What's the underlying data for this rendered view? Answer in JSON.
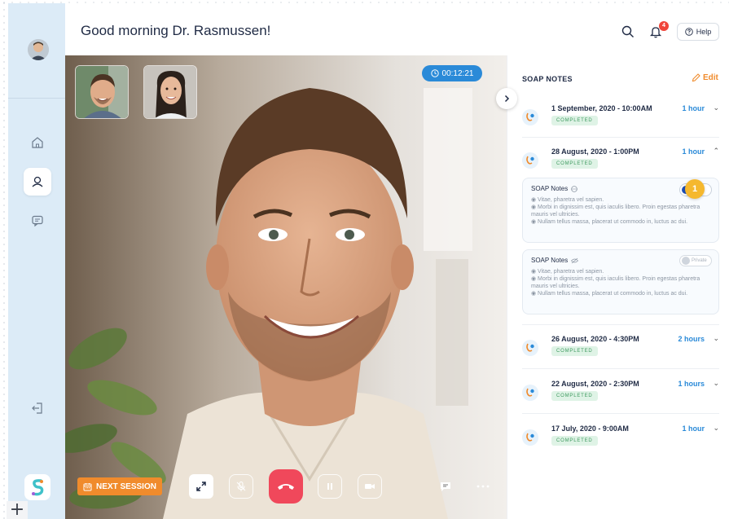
{
  "header": {
    "greeting": "Good morning Dr. Rasmussen!",
    "notification_count": "4",
    "help_label": "Help"
  },
  "sidebar": {
    "items": [
      {
        "name": "home",
        "icon": "home-icon"
      },
      {
        "name": "profile",
        "icon": "user-icon"
      },
      {
        "name": "messages",
        "icon": "chat-icon"
      },
      {
        "name": "logout",
        "icon": "logout-icon"
      }
    ]
  },
  "video": {
    "timer": "00:12:21",
    "next_session_label": "NEXT SESSION"
  },
  "panel": {
    "title": "SOAP NOTES",
    "edit_label": "Edit",
    "sessions": [
      {
        "date": "1 September, 2020 - 10:00AM",
        "duration": "1 hour",
        "status": "COMPLETED"
      },
      {
        "date": "28 August, 2020 - 1:00PM",
        "duration": "1 hour",
        "status": "COMPLETED"
      },
      {
        "date": "26 August, 2020 - 4:30PM",
        "duration": "2 hours",
        "status": "COMPLETED"
      },
      {
        "date": "22 August, 2020 - 2:30PM",
        "duration": "1 hours",
        "status": "COMPLETED"
      },
      {
        "date": "17 July, 2020 - 9:00AM",
        "duration": "1 hour",
        "status": "COMPLETED"
      }
    ],
    "notes": [
      {
        "title": "SOAP Notes",
        "toggle_step": "1",
        "lines": [
          "◉ Vitae, pharetra vel sapien.",
          "◉ Morbi in dignissim est, quis iaculis libero. Proin egestas pharetra mauris vel ultricies.",
          "◉ Nullam tellus massa, placerat ut commodo in, luctus ac dui."
        ]
      },
      {
        "title": "SOAP Notes",
        "toggle_label": "Private",
        "lines": [
          "◉ Vitae, pharetra vel sapien.",
          "◉ Morbi in dignissim est, quis iaculis libero. Proin egestas pharetra mauris vel ultricies.",
          "◉ Nullam tellus massa, placerat ut commodo in, luctus ac dui."
        ]
      }
    ]
  },
  "colors": {
    "accent_blue": "#2a8ad8",
    "accent_orange": "#f08b2c",
    "hangup_red": "#f0485b",
    "sidebar_bg": "#dcebf7",
    "status_green": "#3e9a5f"
  }
}
